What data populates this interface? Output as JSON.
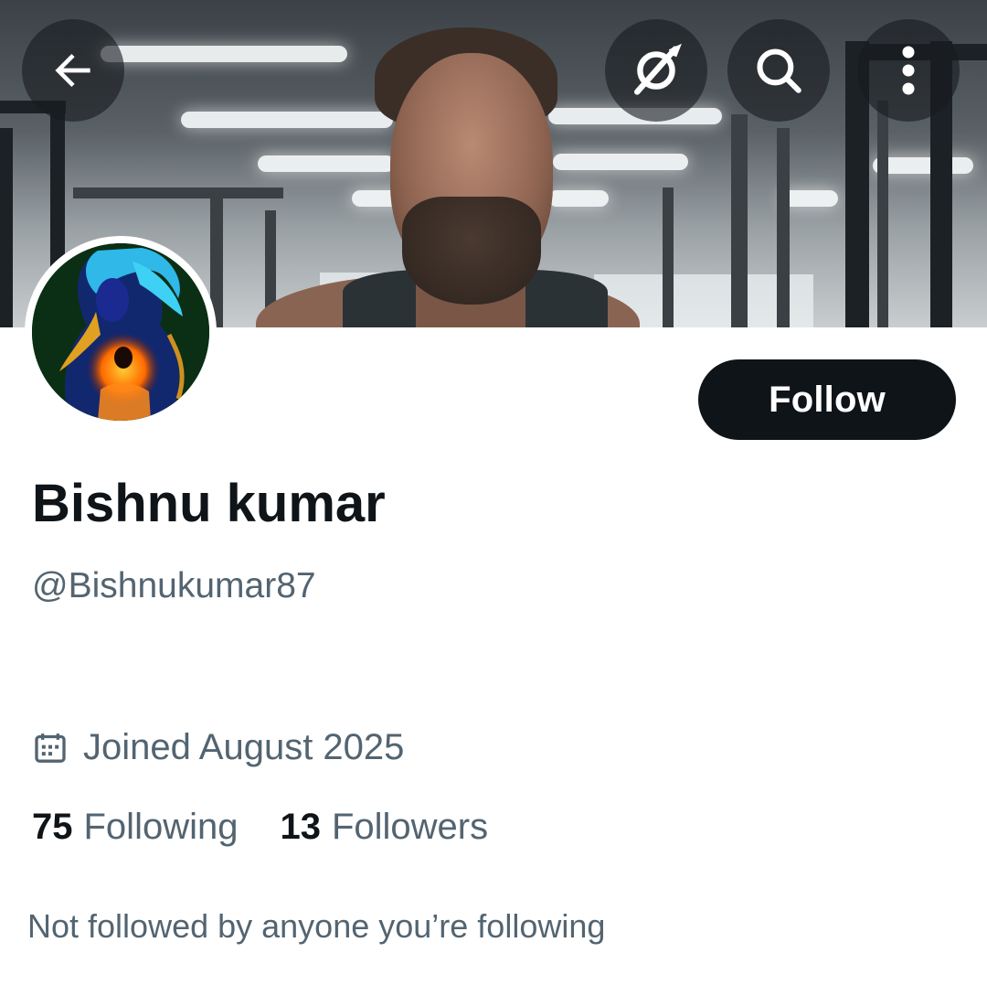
{
  "header": {
    "back_icon": "arrow-left-icon",
    "grok_icon": "grok-icon",
    "search_icon": "search-icon",
    "more_icon": "more-vertical-icon"
  },
  "profile": {
    "display_name": "Bishnu kumar",
    "handle": "@Bishnukumar87",
    "follow_label": "Follow",
    "joined": "Joined August 2025",
    "joined_icon": "calendar-icon",
    "following_count": "75",
    "following_label": "Following",
    "followers_count": "13",
    "followers_label": "Followers",
    "followed_by_text": "Not followed by anyone you’re following"
  },
  "colors": {
    "primary_text": "#0f1419",
    "secondary_text": "#536471",
    "follow_button_bg": "#0f1419",
    "follow_button_text": "#ffffff"
  }
}
